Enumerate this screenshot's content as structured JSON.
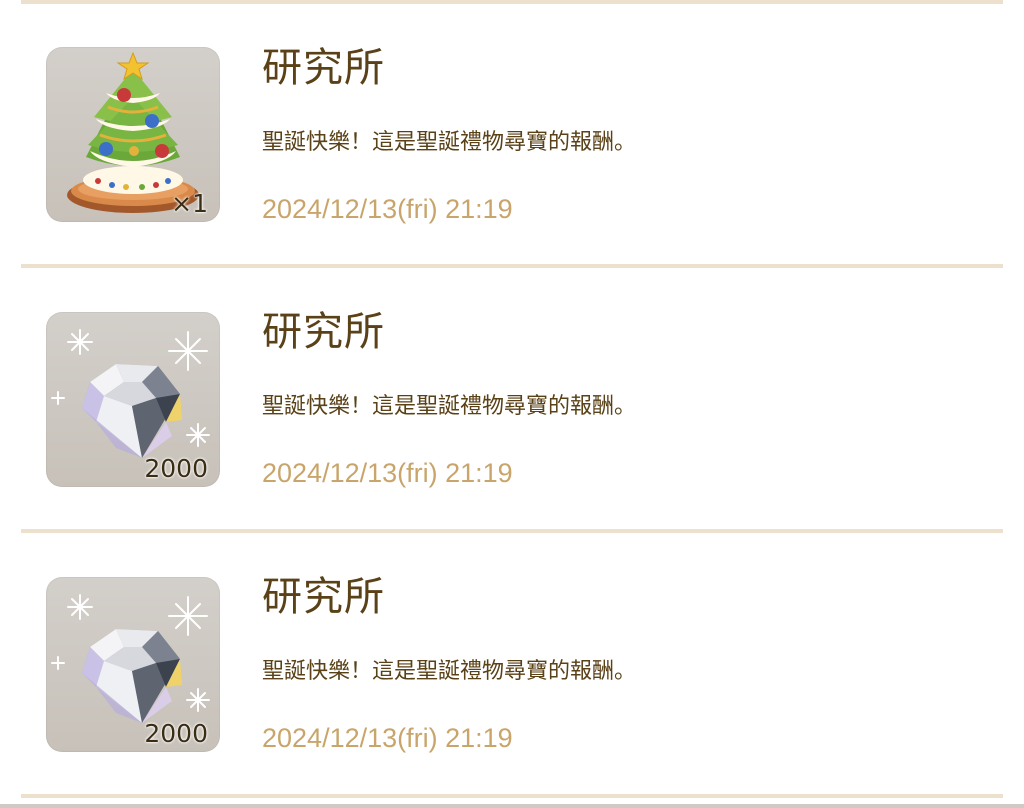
{
  "messages": [
    {
      "sender": "研究所",
      "text": "聖誕快樂！這是聖誕禮物尋寶的報酬。",
      "timestamp": "2024/12/13(fri) 21:19",
      "reward": {
        "icon": "christmas-tree-icon",
        "quantity": "×1"
      }
    },
    {
      "sender": "研究所",
      "text": "聖誕快樂！這是聖誕禮物尋寶的報酬。",
      "timestamp": "2024/12/13(fri) 21:19",
      "reward": {
        "icon": "diamond-icon",
        "quantity": "2000"
      }
    },
    {
      "sender": "研究所",
      "text": "聖誕快樂！這是聖誕禮物尋寶的報酬。",
      "timestamp": "2024/12/13(fri) 21:19",
      "reward": {
        "icon": "diamond-icon",
        "quantity": "2000"
      }
    }
  ],
  "colors": {
    "title": "#5a4117",
    "timestamp": "#c9a56b",
    "divider": "#ede1cd",
    "thumb_bg": "#cdc8c1"
  }
}
